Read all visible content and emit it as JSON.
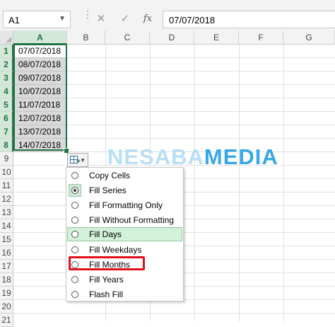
{
  "name_box": {
    "value": "A1"
  },
  "formula_bar": {
    "cancel": "✕",
    "enter": "✓",
    "fx": "fx",
    "value": "07/07/2018"
  },
  "columns": [
    "A",
    "B",
    "C",
    "D",
    "E",
    "F",
    "G"
  ],
  "rows": [
    "1",
    "2",
    "3",
    "4",
    "5",
    "6",
    "7",
    "8",
    "9",
    "10",
    "11",
    "12",
    "13",
    "14",
    "15",
    "16",
    "17",
    "18",
    "19",
    "20",
    "21"
  ],
  "cells_a": [
    "07/07/2018",
    "08/07/2018",
    "09/07/2018",
    "10/07/2018",
    "11/07/2018",
    "12/07/2018",
    "13/07/2018",
    "14/07/2018"
  ],
  "autofill_menu": {
    "items": [
      {
        "label": "Copy Cells",
        "selected": false
      },
      {
        "label": "Fill Series",
        "selected": true
      },
      {
        "label": "Fill Formatting Only",
        "selected": false
      },
      {
        "label": "Fill Without Formatting",
        "selected": false
      },
      {
        "label": "Fill Days",
        "selected": false,
        "highlighted": true
      },
      {
        "label": "Fill Weekdays",
        "selected": false
      },
      {
        "label": "Fill Months",
        "selected": false,
        "outlined": true
      },
      {
        "label": "Fill Years",
        "selected": false
      },
      {
        "label": "Flash Fill",
        "selected": false
      }
    ]
  },
  "watermark": {
    "part1": "NESABA",
    "part2": "MEDIA"
  },
  "colors": {
    "excel_green": "#217346",
    "highlight": "#d3f0d9",
    "outline_red": "#e0101a",
    "watermark_blue": "#37a8e8"
  }
}
